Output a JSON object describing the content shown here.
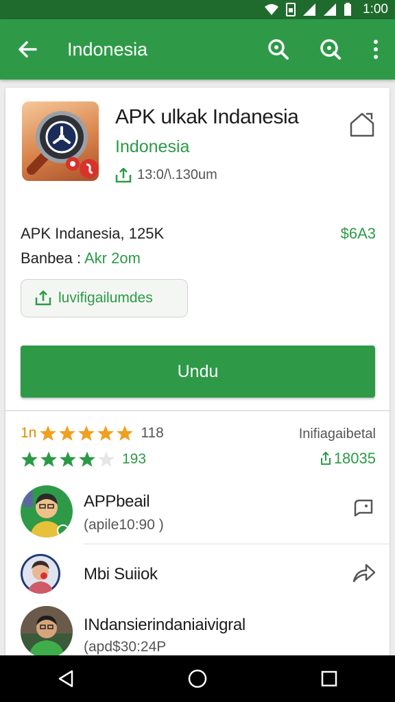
{
  "status_bar": {
    "time": "1:00"
  },
  "app_bar": {
    "title": "Indonesia"
  },
  "app": {
    "title": "APK ulkak Indanesia",
    "developer": "Indonesia",
    "meta": "13:0/\\.130um"
  },
  "details": {
    "line1": "APK Indanesia, 125K",
    "line2_prefix": "Banbea :",
    "line2_value": "Akr 2om",
    "price": "$6A3"
  },
  "install_chip": {
    "label": "luvifigailumdes"
  },
  "download_button": {
    "label": "Undu"
  },
  "ratings": {
    "row1_lead": "1n",
    "row1_count": "118",
    "row2_count": "193",
    "right_label": "Inifiagaibetal",
    "right_value": "18035",
    "row1_stars": 5,
    "row2_stars": 4
  },
  "list": [
    {
      "title": "APPbeail",
      "subtitle": "(apile10:90  )"
    },
    {
      "title": "Mbi Suiiok",
      "subtitle": ""
    },
    {
      "title": "INdansierindaniaivigral",
      "subtitle": "(apd$30:24P"
    }
  ],
  "colors": {
    "accent": "#2e9a48",
    "status_bar": "#1f6b2d",
    "star_orange": "#f0a020",
    "star_green": "#2a9b45"
  },
  "icons": [
    "back-arrow-icon",
    "search-icon",
    "search-icon-2",
    "more-vert-icon",
    "home-icon",
    "install-icon",
    "share-icon",
    "nav-back-icon",
    "nav-home-icon",
    "nav-recents-icon"
  ]
}
